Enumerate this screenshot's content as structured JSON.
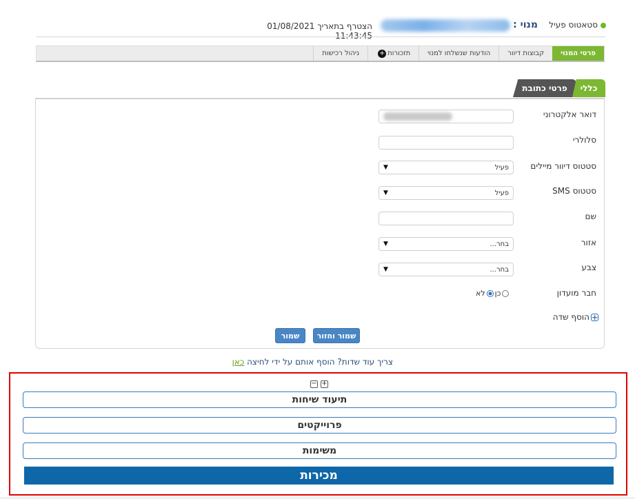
{
  "header": {
    "status_text": "סטאטוס פעיל",
    "subscriber_label": "מנוי :",
    "joined_text": "הצטרף בתאריך 01/08/2021 11:43:45",
    "status_color": "#6fb824"
  },
  "nav": {
    "items": [
      {
        "label": "פרטי המנוי",
        "active": true
      },
      {
        "label": "קבוצות דיוור"
      },
      {
        "label": "הודעות שנשלחו למנוי"
      },
      {
        "label": "תזכורות",
        "icon": "plus-circle-icon"
      },
      {
        "label": "ניהול רכישות"
      }
    ]
  },
  "tabs": {
    "general": "כללי",
    "address": "פרטי כתובת"
  },
  "form": {
    "email_label": "דואר אלקטרוני",
    "mobile_label": "סלולרי",
    "mail_status_label": "סטטוס דיוור מיילים",
    "mail_status_value": "פעיל",
    "sms_status_label": "סטטוס SMS",
    "sms_status_value": "פעיל",
    "name_label": "שם",
    "region_label": "אזור",
    "region_value": "בחר...",
    "color_label": "צבע",
    "color_value": "בחר...",
    "club_label": "חבר מועדון",
    "club_yes": "כן",
    "club_no": "לא",
    "club_selected": "לא",
    "add_field": "הוסף שדה"
  },
  "buttons": {
    "save_return": "שמור וחזור",
    "save": "שמור"
  },
  "hint": {
    "text": "צריך עוד שדות? הוסף אותם על ידי לחיצה",
    "link": "כאן"
  },
  "sections": {
    "call_log": "תיעוד שיחות",
    "projects": "פרוייקטים",
    "tasks": "משימות",
    "sales": "מכירות"
  },
  "colors": {
    "accent_green": "#7cb833",
    "button_blue": "#4a86c5",
    "sales_bar": "#0e67a8",
    "highlight_red": "#e00000"
  }
}
